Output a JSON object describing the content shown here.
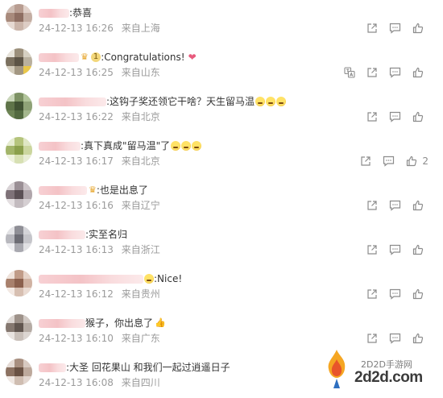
{
  "colors": {
    "meta_text": "#9b9b9b",
    "body_text": "#333333",
    "icon": "#8c8c8c",
    "name_blur": "#f2b8bc"
  },
  "comments": [
    {
      "text": ":恭喜",
      "time": "24-12-13 16:26",
      "location": "来自上海",
      "likes": "",
      "has_translate": false
    },
    {
      "text": ":Congratulations!",
      "time": "24-12-13 16:25",
      "location": "来自山东",
      "likes": "",
      "has_translate": true,
      "badge": "1",
      "heart_emoji": "heart-emoji"
    },
    {
      "text": ":这钩子奖还领它干啥？天生留马温",
      "time": "24-12-13 16:22",
      "location": "来自北京",
      "likes": "",
      "has_translate": false,
      "emoji_count": 3
    },
    {
      "text": ":真下真成\"留马温\"了",
      "time": "24-12-13 16:17",
      "location": "来自北京",
      "likes": "2",
      "has_translate": false,
      "emoji_count": 3
    },
    {
      "text": ":也是出息了",
      "time": "24-12-13 16:16",
      "location": "来自辽宁",
      "likes": "",
      "has_translate": false,
      "crown": true
    },
    {
      "text": ":实至名归",
      "time": "24-12-13 16:13",
      "location": "来自浙江",
      "likes": "",
      "has_translate": false
    },
    {
      "text": ":Nice!",
      "time": "24-12-13 16:12",
      "location": "来自贵州",
      "likes": "",
      "has_translate": false,
      "emoji_count": 1
    },
    {
      "text": "猴子，你出息了",
      "time": "24-12-13 16:10",
      "location": "来自广东",
      "likes": "",
      "has_translate": false,
      "thumb": true
    },
    {
      "text": ":大圣 回花果山 和我们一起过逍遥日子",
      "time": "24-12-13 16:08",
      "location": "来自四川",
      "likes": "",
      "has_translate": false
    }
  ],
  "watermark": {
    "top": "2D2D手游网",
    "main": "2d2d.com"
  },
  "icons": [
    "share-icon",
    "comment-icon",
    "like-icon",
    "translate-icon",
    "flame-logo-icon"
  ]
}
